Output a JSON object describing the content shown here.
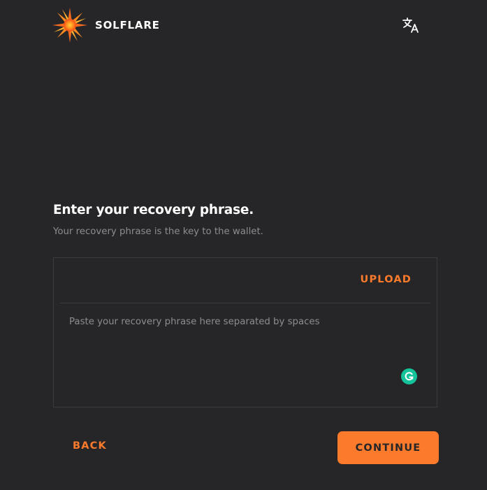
{
  "header": {
    "brand_name": "SOLFLARE",
    "logo_icon": "sun-flare-logo",
    "language_icon": "translate-icon"
  },
  "main": {
    "title": "Enter your recovery phrase.",
    "subtitle": "Your recovery phrase is the key to the wallet.",
    "upload_label": "UPLOAD",
    "phrase_placeholder": "Paste your recovery phrase here separated by spaces",
    "phrase_value": "",
    "grammarly_icon": "grammarly-icon"
  },
  "footer": {
    "back_label": "BACK",
    "continue_label": "CONTINUE"
  },
  "colors": {
    "background": "#262628",
    "accent": "#fc7a2b",
    "text_primary": "#ffffff",
    "text_muted": "#8d8d91",
    "border": "#3b3b3f",
    "grammarly": "#15c39a"
  }
}
